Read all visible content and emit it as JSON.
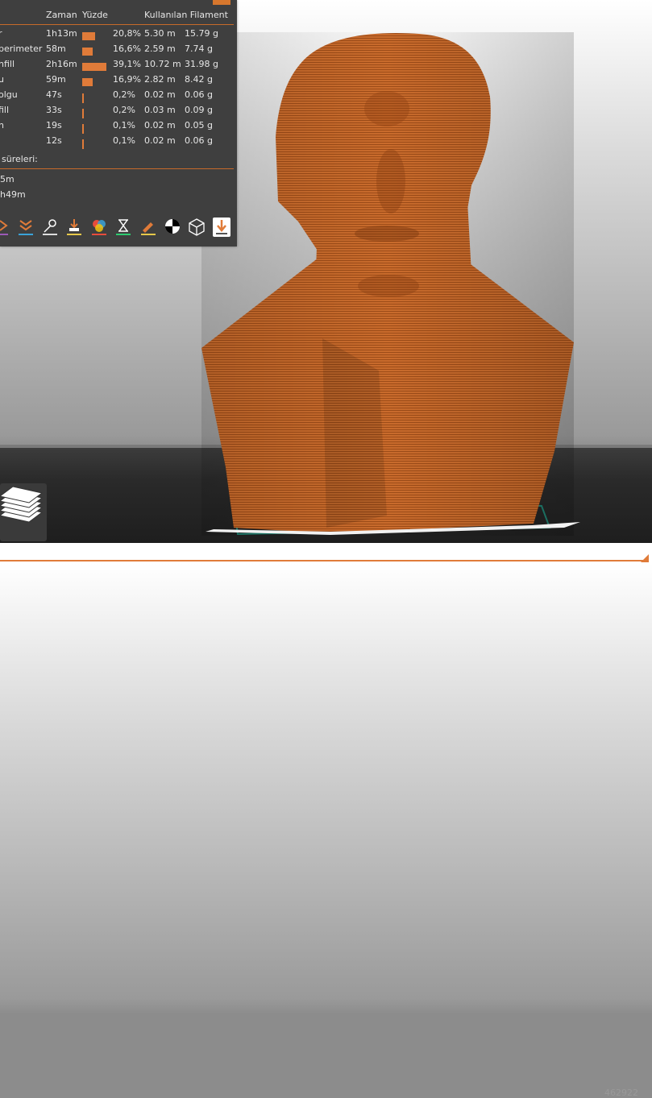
{
  "header": {
    "zaman": "Zaman",
    "yuzde": "Yüzde",
    "kullanilan": "Kullanılan Filament"
  },
  "rows": [
    {
      "name": "r",
      "time": "1h13m",
      "pct_value": 20.8,
      "pct": "20,8%",
      "meters": "5.30 m",
      "grams": "15.79 g"
    },
    {
      "name": "perimeter",
      "time": "58m",
      "pct_value": 16.6,
      "pct": "16,6%",
      "meters": "2.59 m",
      "grams": "7.74 g"
    },
    {
      "name": "nfill",
      "time": "2h16m",
      "pct_value": 39.1,
      "pct": "39,1%",
      "meters": "10.72 m",
      "grams": "31.98 g"
    },
    {
      "name": "u",
      "time": "59m",
      "pct_value": 16.9,
      "pct": "16,9%",
      "meters": "2.82 m",
      "grams": "8.42 g"
    },
    {
      "name": "olgu",
      "time": "47s",
      "pct_value": 0.2,
      "pct": "0,2%",
      "meters": "0.02 m",
      "grams": "0.06 g"
    },
    {
      "name": "fill",
      "time": "33s",
      "pct_value": 0.2,
      "pct": "0,2%",
      "meters": "0.03 m",
      "grams": "0.09 g"
    },
    {
      "name": "n",
      "time": "19s",
      "pct_value": 0.1,
      "pct": "0,1%",
      "meters": "0.02 m",
      "grams": "0.05 g"
    },
    {
      "name": "",
      "time": "12s",
      "pct_value": 0.1,
      "pct": "0,1%",
      "meters": "0.02 m",
      "grams": "0.06 g"
    }
  ],
  "sureleri": "süreleri:",
  "time_line1": "5m",
  "time_line2": "h49m",
  "toolbar_icons": [
    "travel-icon",
    "wipe-icon",
    "retractions-icon",
    "deretractions-icon",
    "color-changes-icon",
    "pause-icon",
    "custom-gcode-icon",
    "seams-icon",
    "shells-icon",
    "tool-marker-icon"
  ],
  "colors": {
    "accent": "#e07b39",
    "panel": "#3f3f3f",
    "model": "#c8682a"
  },
  "view_id": "462922"
}
